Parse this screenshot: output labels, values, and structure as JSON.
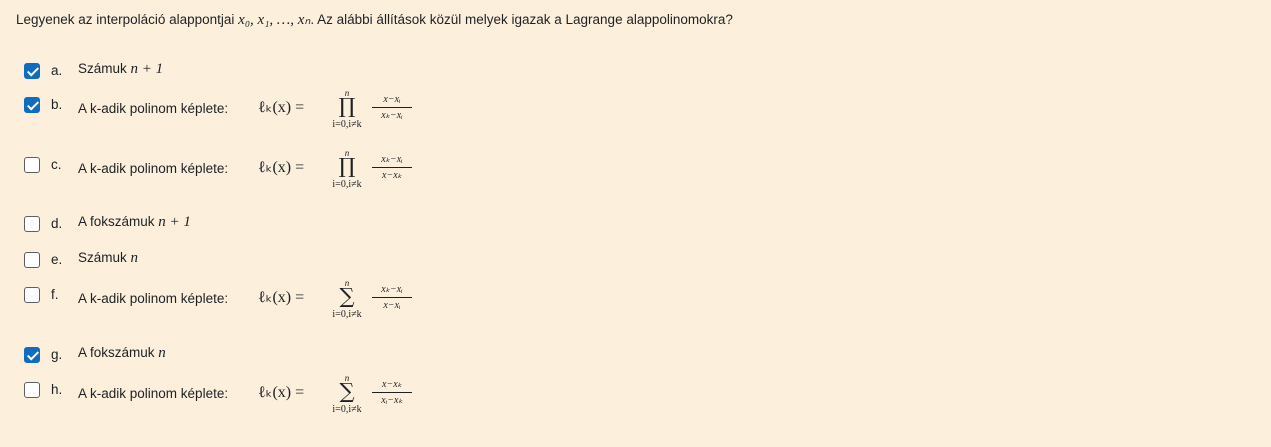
{
  "question": {
    "prefix": "Legyenek az interpoláció alappontjai ",
    "math": "x₀, x₁, …, xₙ",
    "suffix": ". Az alábbi állítások közül melyek igazak a Lagrange alappolinomokra?"
  },
  "options": [
    {
      "letter": "a.",
      "checked": true,
      "text": "Számuk ",
      "math": "n + 1"
    },
    {
      "letter": "b.",
      "checked": true,
      "label": "A k-adik polinom képlete: ",
      "lhs": "ℓₖ(x) =",
      "op": "∏",
      "upper": "n",
      "lower": "i=0,i≠k",
      "num": "x−xᵢ",
      "den": "xₖ−xᵢ"
    },
    {
      "letter": "c.",
      "checked": false,
      "label": "A k-adik polinom képlete: ",
      "lhs": "ℓₖ(x) =",
      "op": "∏",
      "upper": "n",
      "lower": "i=0,i≠k",
      "num": "xₖ−xᵢ",
      "den": "x−xₖ"
    },
    {
      "letter": "d.",
      "checked": false,
      "text": "A fokszámuk ",
      "math": "n + 1"
    },
    {
      "letter": "e.",
      "checked": false,
      "text": "Számuk ",
      "math": "n"
    },
    {
      "letter": "f.",
      "checked": false,
      "label": "A k-adik polinom képlete: ",
      "lhs": "ℓₖ(x) =",
      "op": "∑",
      "upper": "n",
      "lower": "i=0,i≠k",
      "num": "xₖ−xᵢ",
      "den": "x−xᵢ"
    },
    {
      "letter": "g.",
      "checked": true,
      "text": "A fokszámuk ",
      "math": "n"
    },
    {
      "letter": "h.",
      "checked": false,
      "label": "A k-adik polinom képlete: ",
      "lhs": "ℓₖ(x) =",
      "op": "∑",
      "upper": "n",
      "lower": "i=0,i≠k",
      "num": "x−xₖ",
      "den": "xᵢ−xₖ"
    }
  ],
  "colors": {
    "background": "#fcefdc",
    "checkbox_checked": "#0f6cbf",
    "text": "#1d2125"
  }
}
